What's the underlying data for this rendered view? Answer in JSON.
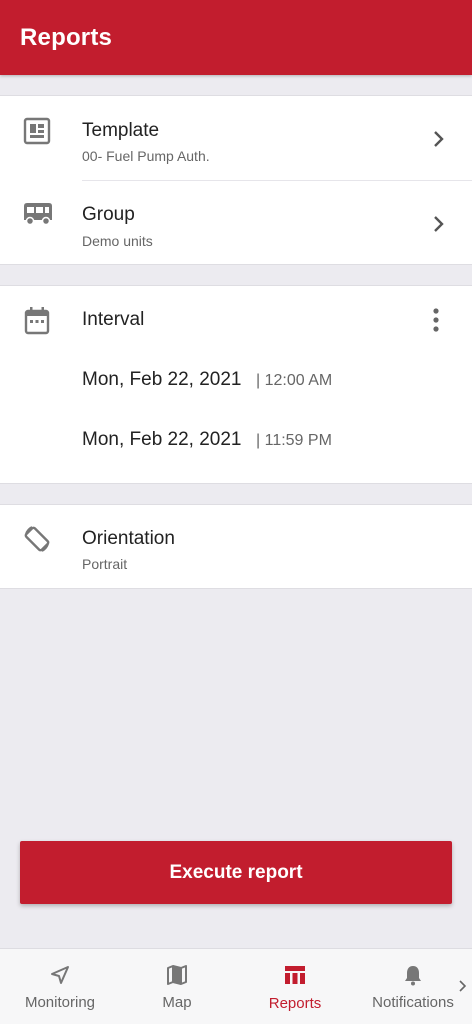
{
  "app_bar": {
    "title": "Reports"
  },
  "template": {
    "label": "Template",
    "value": "00- Fuel Pump Auth."
  },
  "group": {
    "label": "Group",
    "value": "Demo units"
  },
  "interval": {
    "label": "Interval",
    "from_date": "Mon, Feb 22, 2021",
    "from_time": "| 12:00 AM",
    "to_date": "Mon, Feb 22, 2021",
    "to_time": "| 11:59 PM"
  },
  "orientation": {
    "label": "Orientation",
    "value": "Portrait"
  },
  "execute_button": {
    "label": "Execute report"
  },
  "bottom_nav": {
    "items": [
      {
        "label": "Monitoring",
        "icon": "navigation-arrow-icon",
        "active": false
      },
      {
        "label": "Map",
        "icon": "map-icon",
        "active": false
      },
      {
        "label": "Reports",
        "icon": "reports-table-icon",
        "active": true
      },
      {
        "label": "Notifications",
        "icon": "bell-icon",
        "active": false
      }
    ]
  },
  "colors": {
    "accent": "#c21d2e",
    "background": "#ecebf0",
    "icon_gray": "#777777"
  }
}
